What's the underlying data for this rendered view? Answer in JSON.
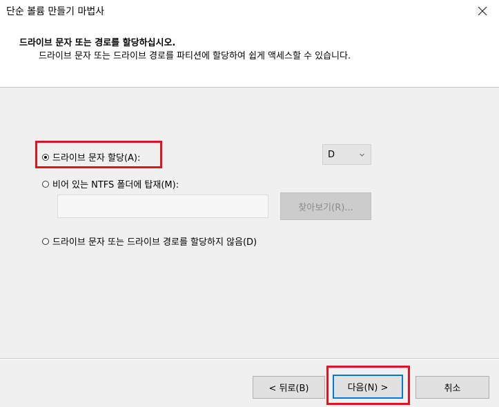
{
  "window": {
    "title": "단순 볼륨 만들기 마법사",
    "close_icon": "close-icon"
  },
  "header": {
    "heading": "드라이브 문자 또는 경로를 할당하십시오.",
    "subheading": "드라이브 문자 또는 드라이브 경로를 파티션에 할당하여 쉽게 액세스할 수 있습니다."
  },
  "options": {
    "assign_letter": {
      "label": "드라이브 문자 할당(A):",
      "checked": true
    },
    "mount_folder": {
      "label": "비어 있는 NTFS 폴더에 탑재(M):",
      "checked": false
    },
    "no_assign": {
      "label": "드라이브 문자 또는 드라이브 경로를 할당하지 않음(D)",
      "checked": false
    }
  },
  "drive_select": {
    "value": "D"
  },
  "folder_input": {
    "value": ""
  },
  "browse_button": {
    "label": "찾아보기(R)...",
    "enabled": false
  },
  "footer": {
    "back_label": "< 뒤로(B)",
    "next_label": "다음(N) >",
    "cancel_label": "취소"
  },
  "colors": {
    "highlight": "#e0141e",
    "default_button_border": "#0078d7"
  }
}
